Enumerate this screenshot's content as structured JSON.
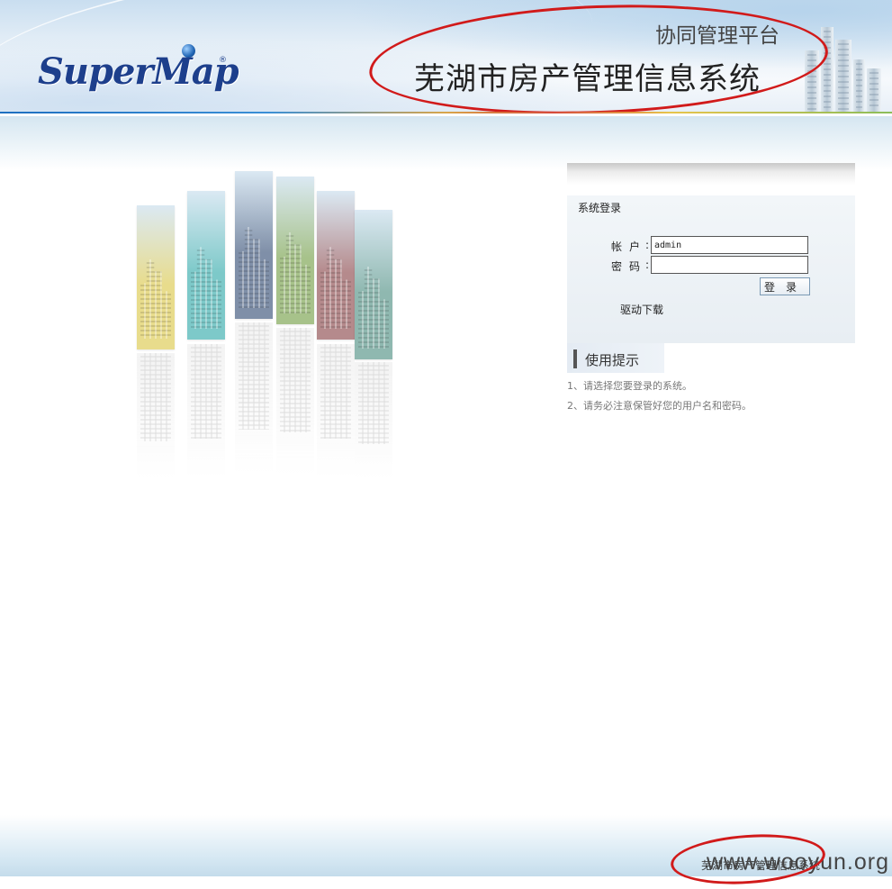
{
  "header": {
    "logo_text": "SuperMap",
    "logo_reg": "®",
    "platform_subtitle": "协同管理平台",
    "system_title": "芜湖市房产管理信息系统"
  },
  "illustration": {
    "panel_colors": [
      "#e8dc8c",
      "#7dc9c9",
      "#7f8fa8",
      "#a7c28a",
      "#b58a8c",
      "#8fb8b0"
    ]
  },
  "login": {
    "title": "系统登录",
    "account_label": "帐户",
    "password_label": "密码",
    "colon": ":",
    "account_value": "admin",
    "password_value": "",
    "login_button": "登录",
    "driver_download": "驱动下载"
  },
  "tips": {
    "title": "使用提示",
    "items": [
      "1、请选择您要登录的系统。",
      "2、请务必注意保管好您的用户名和密码。"
    ]
  },
  "footer": {
    "copyright_text": "芜湖市房产管理信息系统",
    "watermark": "www.wooyun.org"
  },
  "colors": {
    "annotation": "#d11a1a",
    "logo": "#1d3f8c"
  }
}
